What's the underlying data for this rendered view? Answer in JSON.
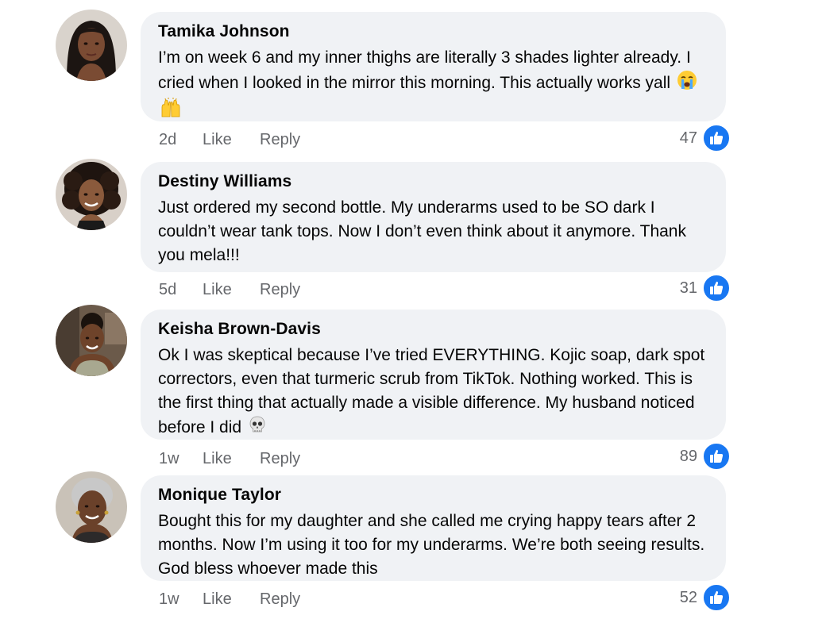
{
  "comments": [
    {
      "author": "Tamika Johnson",
      "text": "I’m on week 6 and my inner thighs are literally 3 shades lighter already. I cried when I looked in the mirror this morning. This actually works yall",
      "emojis": [
        "loudly-crying-face-emoji",
        "raising-hands-emoji"
      ],
      "time": "2d",
      "like_label": "Like",
      "reply_label": "Reply",
      "reaction_count": "47"
    },
    {
      "author": "Destiny Williams",
      "text": "Just ordered my second bottle. My underarms used to be SO dark I couldn’t wear tank tops. Now I don’t even think about it anymore. Thank you mela!!!",
      "emojis": [],
      "time": "5d",
      "like_label": "Like",
      "reply_label": "Reply",
      "reaction_count": "31"
    },
    {
      "author": "Keisha Brown-Davis",
      "text": "Ok I was skeptical because I’ve tried EVERYTHING. Kojic soap, dark spot correctors, even that turmeric scrub from TikTok. Nothing worked. This is the first thing that actually made a visible difference. My husband noticed before I did",
      "emojis": [
        "skull-emoji"
      ],
      "time": "1w",
      "like_label": "Like",
      "reply_label": "Reply",
      "reaction_count": "89"
    },
    {
      "author": "Monique Taylor",
      "text": "Bought this for my daughter and she called me crying happy tears after 2 months. Now I’m using it too for my underarms. We’re both seeing results. God bless whoever made this",
      "emojis": [],
      "time": "1w",
      "like_label": "Like",
      "reply_label": "Reply",
      "reaction_count": "52"
    }
  ],
  "colors": {
    "bubble_bg": "#f0f2f5",
    "meta_text": "#65676b",
    "like_blue": "#1877f2",
    "author_text": "#050505"
  }
}
